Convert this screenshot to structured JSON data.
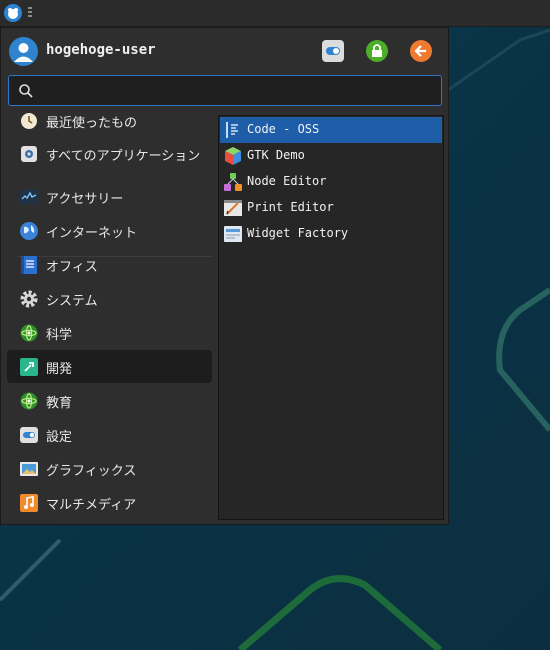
{
  "user": {
    "name": "hogehoge-user"
  },
  "header_buttons": [
    {
      "icon": "settings-toggle-icon",
      "color": "#dcdcdc"
    },
    {
      "icon": "lock-icon",
      "color": "#4caf2a"
    },
    {
      "icon": "logout-icon",
      "color": "#f07a30"
    }
  ],
  "search": {
    "value": "",
    "placeholder": ""
  },
  "categories": [
    {
      "label": "最近使ったもの",
      "icon": "recent-icon"
    },
    {
      "label": "すべてのアプリケーション",
      "icon": "all-apps-icon"
    },
    {
      "label": "アクセサリー",
      "icon": "accessories-icon"
    },
    {
      "label": "インターネット",
      "icon": "internet-globe-icon"
    },
    {
      "label": "オフィス",
      "icon": "office-icon"
    },
    {
      "label": "システム",
      "icon": "system-gear-icon"
    },
    {
      "label": "科学",
      "icon": "science-icon"
    },
    {
      "label": "開発",
      "icon": "development-icon",
      "active": true
    },
    {
      "label": "教育",
      "icon": "education-icon"
    },
    {
      "label": "設定",
      "icon": "settings-icon"
    },
    {
      "label": "グラフィックス",
      "icon": "graphics-icon"
    },
    {
      "label": "マルチメディア",
      "icon": "multimedia-icon"
    }
  ],
  "apps": [
    {
      "label": "Code - OSS",
      "icon": "code-oss-icon",
      "selected": true
    },
    {
      "label": "GTK Demo",
      "icon": "gtk-demo-icon"
    },
    {
      "label": "Node Editor",
      "icon": "node-editor-icon"
    },
    {
      "label": "Print Editor",
      "icon": "print-editor-icon"
    },
    {
      "label": "Widget Factory",
      "icon": "widget-factory-icon"
    }
  ],
  "colors": {
    "accent": "#1e5ea8",
    "search_border": "#2f77c8"
  }
}
